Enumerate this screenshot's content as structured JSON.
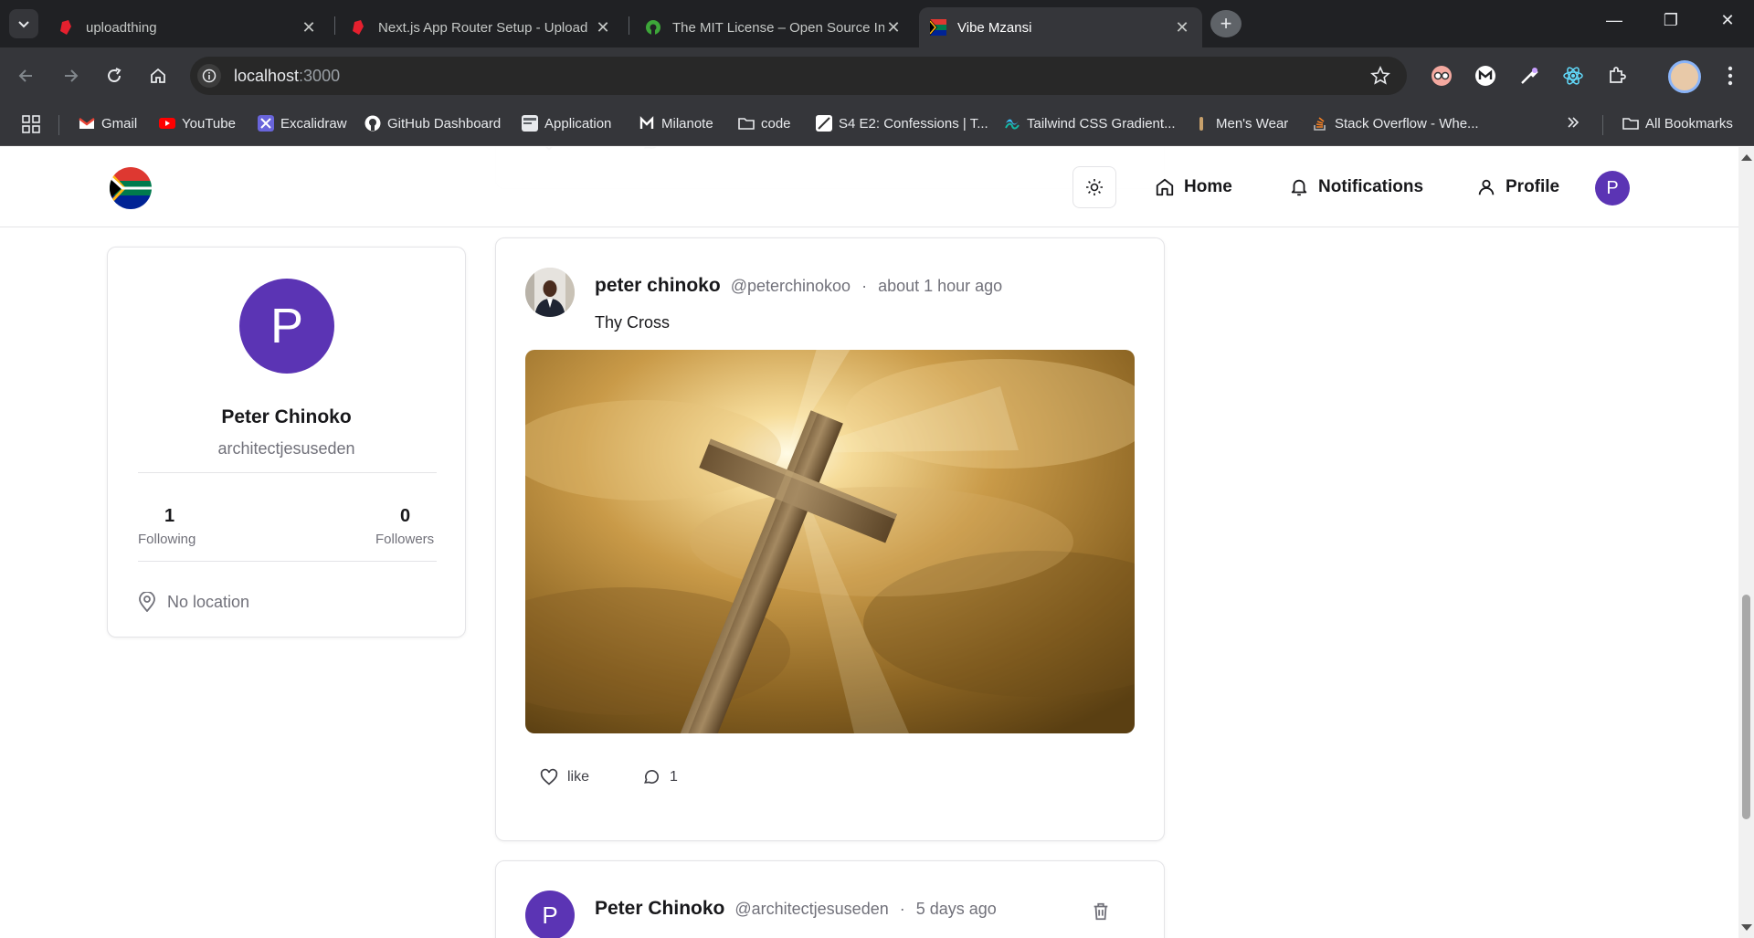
{
  "browser": {
    "tabs": [
      {
        "title": "uploadthing",
        "icon": "uploadthing-icon",
        "active": false
      },
      {
        "title": "Next.js App Router Setup - Upload",
        "icon": "uploadthing-icon",
        "active": false
      },
      {
        "title": "The MIT License – Open Source In",
        "icon": "osi-icon",
        "active": false
      },
      {
        "title": "Vibe Mzansi",
        "icon": "south-africa-flag-icon",
        "active": true
      }
    ],
    "url_host": "localhost",
    "url_port": ":3000",
    "bookmarks": [
      {
        "label": "Gmail",
        "icon": "gmail-icon"
      },
      {
        "label": "YouTube",
        "icon": "youtube-icon"
      },
      {
        "label": "Excalidraw",
        "icon": "excalidraw-icon"
      },
      {
        "label": "GitHub Dashboard",
        "icon": "github-icon"
      },
      {
        "label": "Application",
        "icon": "application-icon"
      },
      {
        "label": "Milanote",
        "icon": "milanote-icon"
      },
      {
        "label": "code",
        "icon": "folder-icon"
      },
      {
        "label": "S4 E2: Confessions | T...",
        "icon": "page-icon"
      },
      {
        "label": "Tailwind CSS Gradient...",
        "icon": "tailwind-icon"
      },
      {
        "label": "Men's Wear",
        "icon": "mens-wear-icon"
      },
      {
        "label": "Stack Overflow - Whe...",
        "icon": "stackoverflow-icon"
      }
    ],
    "all_bookmarks": "All Bookmarks"
  },
  "navbar": {
    "home": "Home",
    "notifications": "Notifications",
    "profile": "Profile",
    "avatar_initial": "P"
  },
  "previous_post": {
    "like_label": "like",
    "comment_label": "comment"
  },
  "profile_card": {
    "initial": "P",
    "name": "Peter Chinoko",
    "username": "architectjesuseden",
    "following_count": "1",
    "following_label": "Following",
    "followers_count": "0",
    "followers_label": "Followers",
    "location": "No location"
  },
  "post": {
    "author": "peter chinoko",
    "handle": "@peterchinokoo",
    "separator": "·",
    "time": "about 1 hour ago",
    "content": "Thy Cross",
    "image_subject": "wooden cross against golden sunlit clouds",
    "like_label": "like",
    "comment_count": "1"
  },
  "post2": {
    "initial": "P",
    "author": "Peter Chinoko",
    "handle": "@architectjesuseden",
    "separator": "·",
    "time": "5 days ago"
  },
  "colors": {
    "accent_purple": "#5b34b4",
    "muted_text": "#71717a",
    "border": "#e4e4e7",
    "chrome_dark": "#35363a"
  }
}
